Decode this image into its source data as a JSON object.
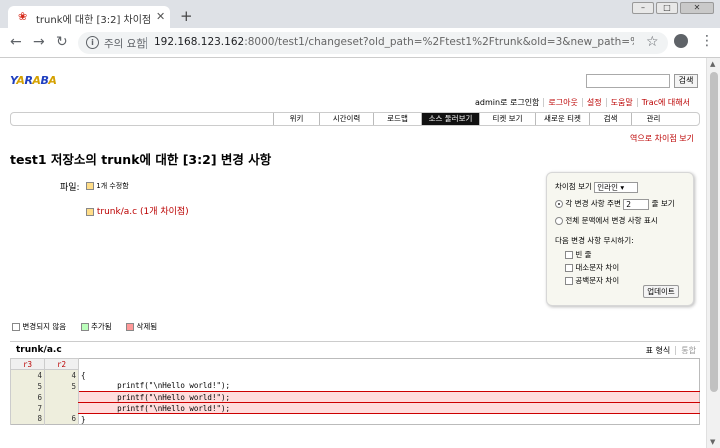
{
  "browser": {
    "tab_title": "trunk에 대한 [3:2] 차이점 – 테스",
    "tab_favicon": "paw-icon",
    "address_warning": "주의 요함",
    "url_host": "192.168.123.162",
    "url_rest": ":8000/test1/changeset?old_path=%2Ftest1%2Ftrunk&old=3&new_path=%2Ftest1%2Ftrunk&..."
  },
  "header": {
    "logo_parts": [
      "Y",
      "A",
      "R",
      "A",
      "B",
      "A"
    ],
    "search_button": "검색"
  },
  "metanav": [
    "admin로 로그인함",
    "로그아웃",
    "설정",
    "도움말",
    "Trac에 대해서"
  ],
  "mainnav": [
    {
      "label": "위키",
      "width": 46
    },
    {
      "label": "시간이력",
      "width": 54
    },
    {
      "label": "로드맵",
      "width": 48
    },
    {
      "label": "소스 둘러보기",
      "width": 58,
      "active": true
    },
    {
      "label": "티켓 보기",
      "width": 56
    },
    {
      "label": "새로운 티켓",
      "width": 54
    },
    {
      "label": "검색",
      "width": 42
    },
    {
      "label": "관리",
      "width": 44
    }
  ],
  "ctxnav": "역으로 차이점 보기",
  "page_title": "test1 저장소의 trunk에 대한 [3:2] 변경 사항",
  "files": {
    "label": "파일:",
    "count": "1개 수정함",
    "path": "trunk/a.c",
    "diff_count": "(1개 차이점)"
  },
  "prefs": {
    "view_label": "차이점 보기",
    "view_select": "인라인",
    "radio1_label": "각 변경 사항 주변",
    "context_lines": "2",
    "radio1_suffix": "줄 보기",
    "radio2_label": "전체 문맥에서 변경 사항 표시",
    "ignore_label": "다음 변경 사항 무시하기:",
    "ignore_options": [
      "빈 줄",
      "대소문자 차이",
      "공백문자 차이"
    ],
    "update_button": "업데이트"
  },
  "legend": [
    "변경되지 않음",
    "추가됨",
    "삭제됨"
  ],
  "diff": {
    "filename": "trunk/a.c",
    "tab_table": "표 형식",
    "tab_unified": "통합",
    "col_old": "r3",
    "col_new": "r2",
    "rows": [
      {
        "old": "4",
        "new": "4",
        "code": "{",
        "type": "ctx"
      },
      {
        "old": "5",
        "new": "5",
        "code": "        printf(\"\\nHello world!\");",
        "type": "ctx"
      },
      {
        "old": "6",
        "new": "",
        "code": "        printf(\"\\nHello world!\");",
        "type": "rem"
      },
      {
        "old": "7",
        "new": "",
        "code": "        printf(\"\\nHello world!\");",
        "type": "rem"
      },
      {
        "old": "8",
        "new": "6",
        "code": "}",
        "type": "ctx"
      }
    ]
  }
}
